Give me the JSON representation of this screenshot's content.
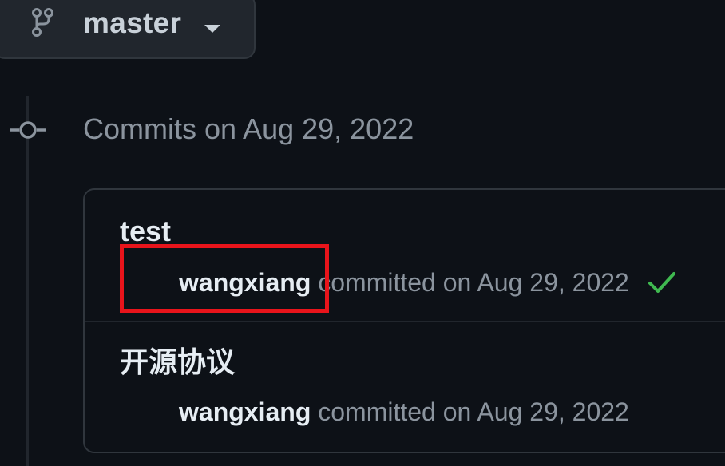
{
  "branch": {
    "icon": "git-branch-icon",
    "name": "master",
    "caret_icon": "caret-down-icon"
  },
  "timeline": {
    "node_icon": "git-commit-icon",
    "group_title": "Commits on Aug 29, 2022"
  },
  "commits": [
    {
      "title": "test",
      "author": "wangxiang",
      "meta": "committed on Aug 29, 2022",
      "status_icon": "check-icon",
      "status_color": "#3fb950"
    },
    {
      "title": "开源协议",
      "author": "wangxiang",
      "meta": "committed on Aug 29, 2022"
    }
  ],
  "annotation": {
    "highlight_color": "#e8141b"
  }
}
